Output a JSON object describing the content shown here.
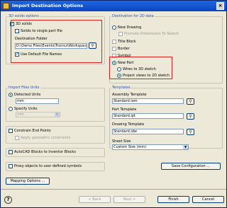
{
  "window": {
    "title": "Import Destination Options",
    "close_glyph": "×"
  },
  "solids": {
    "group_label": "3D solids options",
    "cb_3d_solids": {
      "label": "3D solids",
      "checked": true
    },
    "cb_single_part": {
      "label": "Solids to single part file",
      "checked": false
    },
    "dest_folder_label": "Destination Folder",
    "dest_folder_value": "D:\\Demo Files\\Events\\Tronics\\Workspace",
    "cb_default_names": {
      "label": "Use Default File Names",
      "checked": true
    }
  },
  "destination2d": {
    "group_label": "Destination for 2D data",
    "new_drawing": "New Drawing",
    "promote_dims": "Promote Dimensions To Sketch",
    "title_block": "Title Block",
    "border": "Border",
    "symbol": "Symbol",
    "new_part": "New Part",
    "wires_3d": "Wires to 3D sketch",
    "project_2d": "Project views to 2D sketch",
    "selected": "new_part",
    "sub_selected": "project_2d"
  },
  "import_units": {
    "group_label": "Import Files Units",
    "detected": "Detected Units",
    "detected_value": "mm",
    "specify": "Specify Units",
    "specify_value": "mm",
    "selected": "detected"
  },
  "options": {
    "constrain_end_points": "Constrain End Points",
    "apply_geometric": "Apply geometric constraints",
    "autocad_blocks": "AutoCAD Blocks to Inventor Blocks",
    "proxy_objects": "Proxy objects to user defined symbols",
    "mapping_button": "Mapping Options ..."
  },
  "templates": {
    "group_label": "Templates",
    "assembly_label": "Assembly Template",
    "assembly_value": "Standard.iam",
    "part_label": "Part Template",
    "part_value": "Standard.ipt",
    "drawing_label": "Drawing Template",
    "drawing_value": "Standard.idw",
    "sheet_label": "Sheet Size",
    "sheet_value": "Custom Size (mm)",
    "save_config": "Save Configuration ..."
  },
  "footer": {
    "back": "< Back",
    "next": "Next >",
    "finish": "Finish",
    "cancel": "Cancel"
  },
  "icons": {
    "browse": "browse-magnifier-icon",
    "check": "✓",
    "dropdown": "▼"
  },
  "colors": {
    "title_bar": "#0a44c0",
    "group_label": "#2850b0",
    "highlight_box": "#e02020"
  }
}
